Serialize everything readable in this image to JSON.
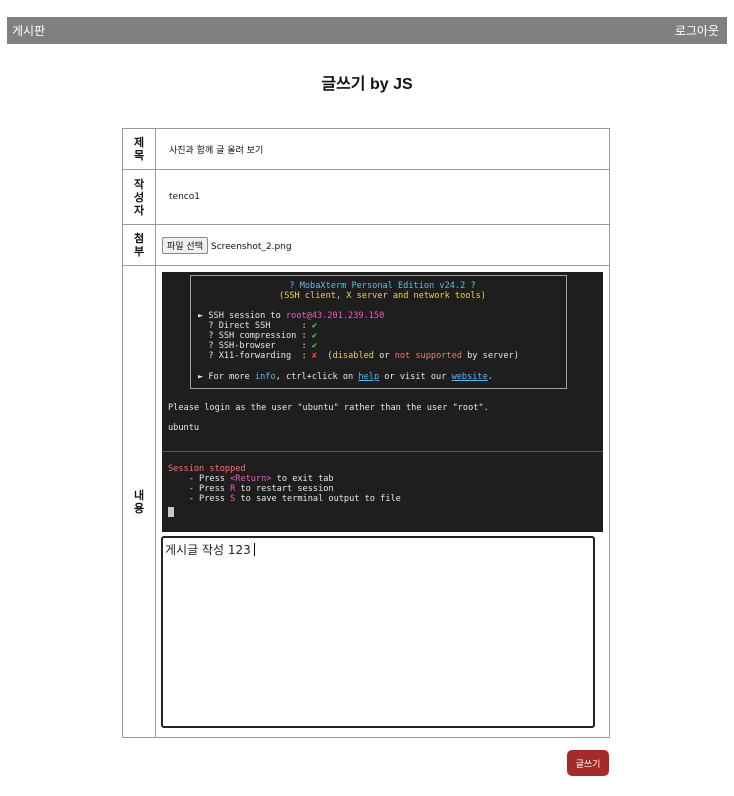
{
  "header": {
    "board_label": "게시판",
    "logout_label": "로그아웃"
  },
  "page": {
    "title": "글쓰기 by JS"
  },
  "form": {
    "title_label": [
      "제",
      "목"
    ],
    "title_value": "사진과 함께 글 올려 보기",
    "author_label": [
      "작",
      "성",
      "자"
    ],
    "author_value": "tenco1",
    "attach_label": [
      "첨",
      "부"
    ],
    "file_button_label": "파일 선택",
    "file_name": "Screenshot_2.png",
    "content_label": [
      "내",
      "용"
    ],
    "content_text": "게시글 작성 123",
    "submit_label": "글쓰기"
  },
  "terminal": {
    "banner_title": "? MobaXterm Personal Edition v24.2 ?",
    "banner_subtitle": "(SSH client, X server and network tools)",
    "ssh_prefix": "► SSH session to ",
    "ssh_host": "root@43.201.239.150",
    "direct_ssh": "  ? Direct SSH      :",
    "ssh_compression": "  ? SSH compression :",
    "ssh_browser": "  ? SSH-browser     :",
    "x11_forwarding": "  ? X11-forwarding  :",
    "check_mark": "✔",
    "cross_mark": "✘",
    "x11_open": "(",
    "x11_disabled": "disabled",
    "x11_or": " or ",
    "x11_not_supported": "not supported",
    "x11_by_server": " by server)",
    "more_info_prefix": "► For more ",
    "info_word": "info",
    "more_info_mid": ", ctrl+click on ",
    "help_word": "help",
    "more_info_visit": " or visit our ",
    "website_word": "website",
    "more_info_end": ".",
    "login_message": "Please login as the user \"ubuntu\" rather than the user \"root\".",
    "ubuntu_line": "ubuntu",
    "session_stopped": "Session stopped",
    "press_prefix": "    - Press ",
    "return_key": "<Return>",
    "exit_tab": " to exit tab",
    "r_key": "R",
    "restart_session": " to restart session",
    "s_key": "S",
    "save_output": " to save terminal output to file"
  }
}
